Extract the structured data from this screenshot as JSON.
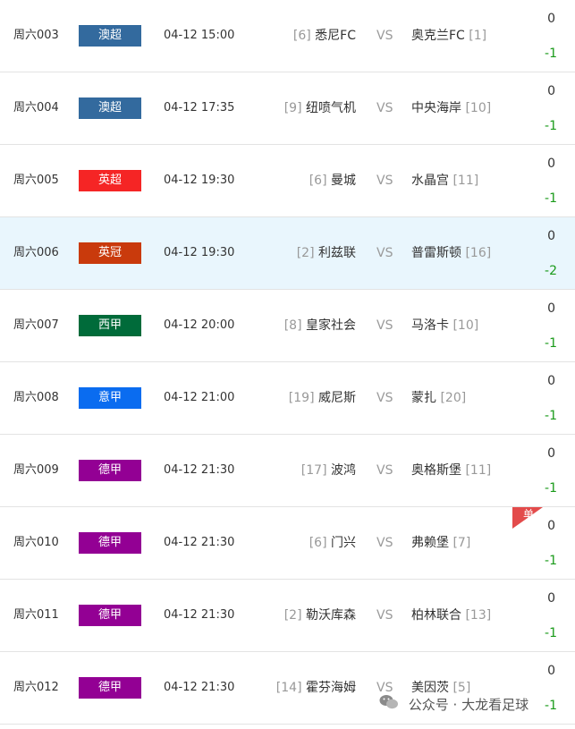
{
  "colors": {
    "澳超": "#336a9e",
    "英超": "#f52525",
    "英冠": "#c93a0c",
    "西甲": "#006b3a",
    "意甲": "#0a6cf0",
    "德甲": "#930094",
    "highlight_row": "#e9f6fd",
    "handicap_green": "#1a9a1a"
  },
  "matches": [
    {
      "num": "周六003",
      "league": "澳超",
      "time": "04-12 15:00",
      "home_rank": "[6]",
      "home": "悉尼FC",
      "vs": "VS",
      "away": "奥克兰FC",
      "away_rank": "[1]",
      "h0": "0",
      "h1": "-1"
    },
    {
      "num": "周六004",
      "league": "澳超",
      "time": "04-12 17:35",
      "home_rank": "[9]",
      "home": "纽喷气机",
      "vs": "VS",
      "away": "中央海岸",
      "away_rank": "[10]",
      "h0": "0",
      "h1": "-1"
    },
    {
      "num": "周六005",
      "league": "英超",
      "time": "04-12 19:30",
      "home_rank": "[6]",
      "home": "曼城",
      "vs": "VS",
      "away": "水晶宫",
      "away_rank": "[11]",
      "h0": "0",
      "h1": "-1"
    },
    {
      "num": "周六006",
      "league": "英冠",
      "time": "04-12 19:30",
      "home_rank": "[2]",
      "home": "利兹联",
      "vs": "VS",
      "away": "普雷斯顿",
      "away_rank": "[16]",
      "h0": "0",
      "h1": "-2"
    },
    {
      "num": "周六007",
      "league": "西甲",
      "time": "04-12 20:00",
      "home_rank": "[8]",
      "home": "皇家社会",
      "vs": "VS",
      "away": "马洛卡",
      "away_rank": "[10]",
      "h0": "0",
      "h1": "-1"
    },
    {
      "num": "周六008",
      "league": "意甲",
      "time": "04-12 21:00",
      "home_rank": "[19]",
      "home": "威尼斯",
      "vs": "VS",
      "away": "蒙扎",
      "away_rank": "[20]",
      "h0": "0",
      "h1": "-1"
    },
    {
      "num": "周六009",
      "league": "德甲",
      "time": "04-12 21:30",
      "home_rank": "[17]",
      "home": "波鸿",
      "vs": "VS",
      "away": "奥格斯堡",
      "away_rank": "[11]",
      "h0": "0",
      "h1": "-1"
    },
    {
      "num": "周六010",
      "league": "德甲",
      "time": "04-12 21:30",
      "home_rank": "[6]",
      "home": "门兴",
      "vs": "VS",
      "away": "弗赖堡",
      "away_rank": "[7]",
      "h0": "0",
      "h1": "-1",
      "badge": "单"
    },
    {
      "num": "周六011",
      "league": "德甲",
      "time": "04-12 21:30",
      "home_rank": "[2]",
      "home": "勒沃库森",
      "vs": "VS",
      "away": "柏林联合",
      "away_rank": "[13]",
      "h0": "0",
      "h1": "-1"
    },
    {
      "num": "周六012",
      "league": "德甲",
      "time": "04-12 21:30",
      "home_rank": "[14]",
      "home": "霍芬海姆",
      "vs": "VS",
      "away": "美因茨",
      "away_rank": "[5]",
      "h0": "0",
      "h1": "-1"
    }
  ],
  "watermark": {
    "text": "公众号 · 大龙看足球",
    "icon": "wechat-icon"
  }
}
